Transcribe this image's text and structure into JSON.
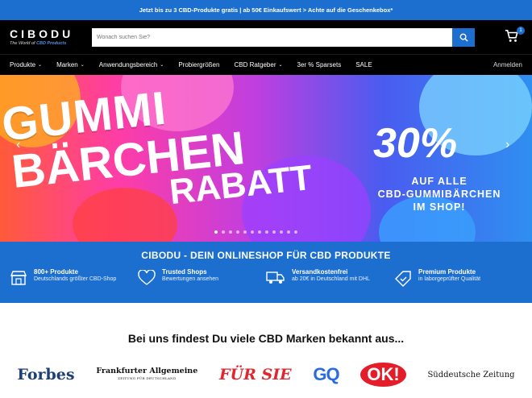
{
  "topbar": {
    "text": "Jetzt bis zu 3 CBD-Produkte gratis | ab 50€ Einkaufswert > Achte auf die Geschenkebox*"
  },
  "header": {
    "logo": "CIBODU",
    "logo_sub_prefix": "The World of",
    "logo_sub_strong": "CBD Products",
    "search_placeholder": "Wonach suchen Sie?",
    "cart_count": "1"
  },
  "nav": {
    "items": [
      {
        "label": "Produkte"
      },
      {
        "label": "Marken"
      },
      {
        "label": "Anwendungsbereich"
      },
      {
        "label": "Probiergrößen"
      },
      {
        "label": "CBD Ratgeber"
      },
      {
        "label": "3er % Sparsets"
      },
      {
        "label": "SALE"
      }
    ],
    "login": "Anmelden"
  },
  "hero": {
    "line1": "GUMMI",
    "line2": "BÄRCHEN",
    "line3": "RABATT",
    "percent": "30%",
    "sub1": "AUF ALLE",
    "sub2": "CBD-GUMMIBÄRCHEN",
    "sub3": "IM SHOP!"
  },
  "band": {
    "title": "CIBODU - DEIN ONLINESHOP FÜR CBD PRODUKTE",
    "features": [
      {
        "title": "800+ Produkte",
        "desc": "Deutschlands größter CBD-Shop"
      },
      {
        "title": "Trusted Shops",
        "desc": "Bewertungen ansehen"
      },
      {
        "title": "Versandkostenfrei",
        "desc": "ab 20€ in Deutschland mit DHL"
      },
      {
        "title": "Premium Produkte",
        "desc": "in laborgeprüfter Qualität"
      }
    ]
  },
  "brands": {
    "heading": "Bei uns findest Du viele CBD Marken bekannt aus...",
    "logos": [
      "Forbes",
      "Frankfurter Allgemeine",
      "ZEITUNG FÜR DEUTSCHLAND",
      "FÜR SIE",
      "GQ",
      "OK!",
      "Süddeutsche Zeitung"
    ]
  },
  "colors": {
    "accent": "#1d6fcf",
    "header": "#000000"
  }
}
